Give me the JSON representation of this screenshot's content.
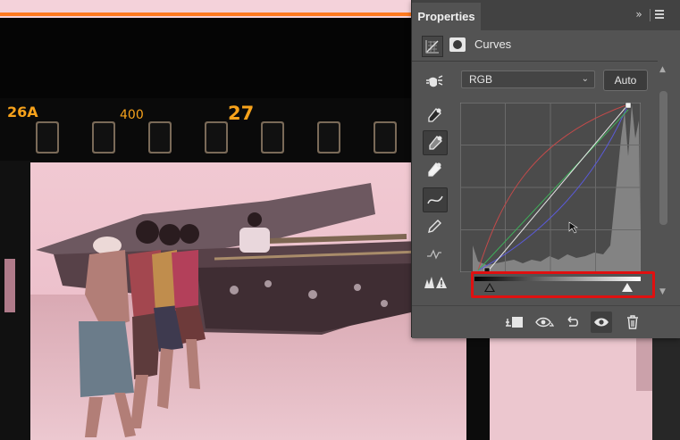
{
  "film": {
    "edge_codes": [
      "26A",
      "400",
      "27"
    ]
  },
  "panel": {
    "tab": "Properties",
    "adjustment_name": "Curves",
    "channel": {
      "selected": "RGB"
    },
    "auto_label": "Auto"
  },
  "colors": {
    "panel_bg": "#535353",
    "highlight": "#e01010",
    "film_text": "#f7a21b"
  },
  "icons": {
    "tools": [
      "on-image-adjust-icon",
      "black-point-eyedropper-icon",
      "gray-point-eyedropper-icon",
      "white-point-eyedropper-icon",
      "curve-edit-points-icon",
      "pencil-icon",
      "smooth-icon",
      "clipping-warning-icon"
    ],
    "bottom": [
      "clip-to-layer-icon",
      "view-previous-state-icon",
      "reset-icon",
      "visibility-eye-icon",
      "delete-icon"
    ]
  }
}
